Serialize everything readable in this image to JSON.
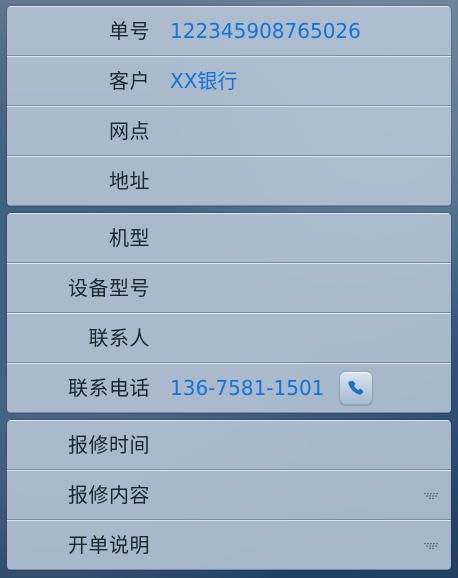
{
  "form": {
    "rows": [
      {
        "label": "单号",
        "value": "12234590876502­6"
      },
      {
        "label": "客户",
        "value": "XX银行"
      },
      {
        "label": "网点",
        "value": ""
      },
      {
        "label": "地址",
        "value": ""
      },
      {
        "label": "机型",
        "value": ""
      },
      {
        "label": "设备型号",
        "value": ""
      },
      {
        "label": "联系人",
        "value": ""
      },
      {
        "label": "联系电话",
        "value": "136-7581-1501"
      },
      {
        "label": "报修时间",
        "value": ""
      },
      {
        "label": "报修内容",
        "value": ""
      },
      {
        "label": "开单说明",
        "value": ""
      }
    ]
  },
  "icons": {
    "phone": "phone-icon",
    "dropdown": "chevron-down-icon"
  },
  "colors": {
    "label": "#1a2632",
    "value": "#0f74db",
    "row_background": "#b5c3d4",
    "phone_icon": "#1d6fc9"
  }
}
